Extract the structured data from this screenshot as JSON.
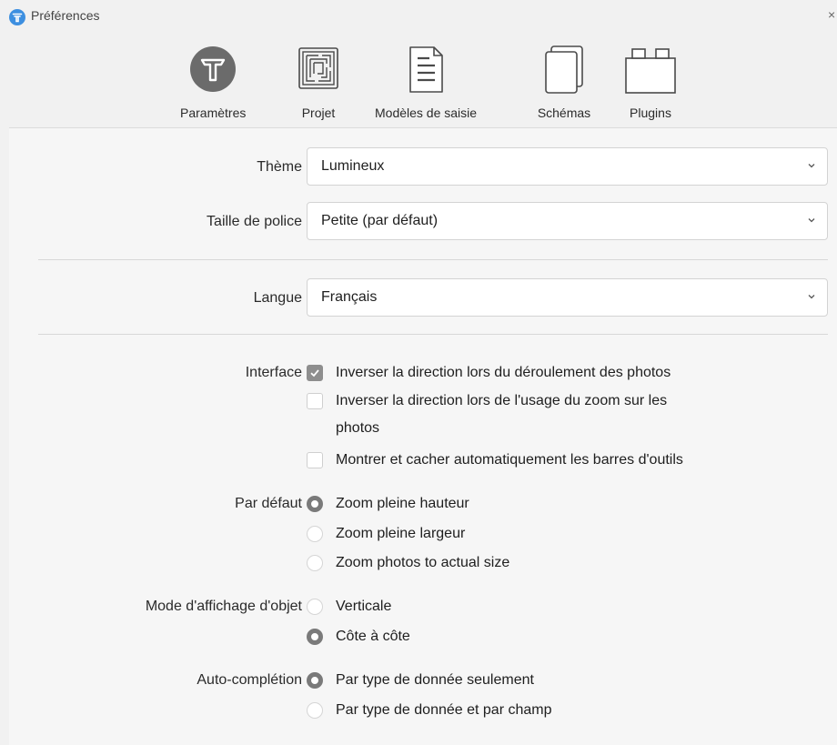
{
  "window": {
    "title": "Préférences",
    "close_glyph": "×"
  },
  "toolbar": {
    "items": [
      {
        "label": "Paramètres",
        "icon": "settings-icon",
        "selected": true
      },
      {
        "label": "Projet",
        "icon": "maze-icon",
        "selected": false
      },
      {
        "label": "Modèles de saisie",
        "icon": "document-icon",
        "selected": false
      },
      {
        "label": "Schémas",
        "icon": "pages-icon",
        "selected": false
      },
      {
        "label": "Plugins",
        "icon": "plugin-icon",
        "selected": false
      }
    ]
  },
  "settings": {
    "theme": {
      "label": "Thème",
      "value": "Lumineux"
    },
    "font_size": {
      "label": "Taille de police",
      "value": "Petite (par défaut)"
    },
    "language": {
      "label": "Langue",
      "value": "Français"
    },
    "interface": {
      "label": "Interface",
      "options": [
        {
          "text": "Inverser la direction lors du déroulement des photos",
          "checked": true
        },
        {
          "text_line1": "Inverser la direction lors de l'usage du zoom sur les",
          "text_line2": "photos",
          "checked": false
        },
        {
          "text": "Montrer et cacher automatiquement les barres d'outils",
          "checked": false
        }
      ]
    },
    "default_zoom": {
      "label": "Par défaut",
      "options": [
        {
          "text": "Zoom pleine hauteur",
          "selected": true
        },
        {
          "text": "Zoom pleine largeur",
          "selected": false
        },
        {
          "text": "Zoom photos to actual size",
          "selected": false
        }
      ]
    },
    "object_display": {
      "label": "Mode d'affichage d'objet",
      "options": [
        {
          "text": "Verticale",
          "selected": false
        },
        {
          "text": "Côte à côte",
          "selected": true
        }
      ]
    },
    "autocomplete": {
      "label": "Auto-complétion",
      "options": [
        {
          "text": "Par type de donnée seulement",
          "selected": true
        },
        {
          "text": "Par type de donnée et par champ",
          "selected": false
        }
      ]
    }
  },
  "colors": {
    "app_icon": "#3d8fe0",
    "selected_icon_bg": "#6b6b6b",
    "checked": "#8e8e8e"
  }
}
